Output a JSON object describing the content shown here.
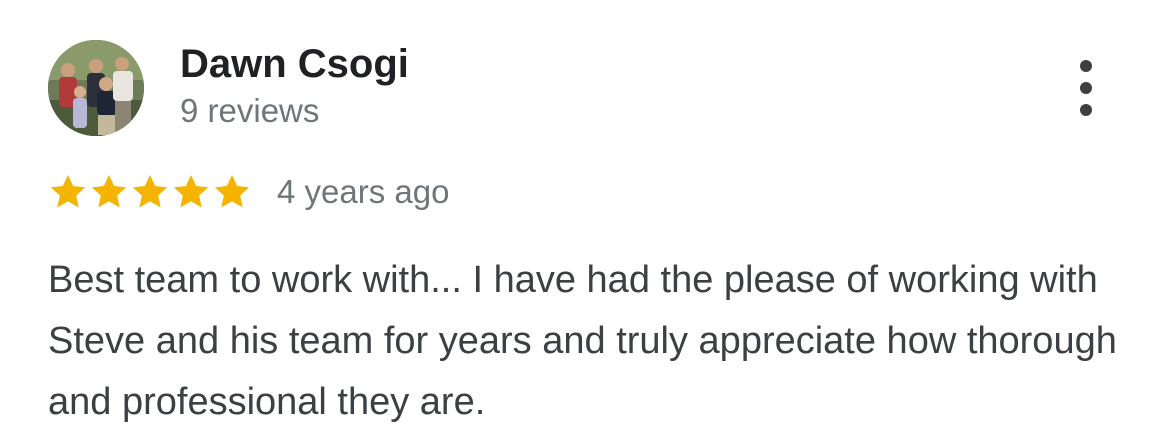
{
  "reviewer": {
    "name": "Dawn Csogi",
    "review_count": "9 reviews",
    "avatar_icon": "family-photo-avatar"
  },
  "review": {
    "rating": 5,
    "rating_max": 5,
    "date": "4 years ago",
    "text": "Best team to work with... I have had the please of working with Steve and his team for years and truly appreciate how thorough and professional they are."
  },
  "menu": {
    "icon": "more-vertical-icon"
  },
  "colors": {
    "star": "#f4b400",
    "name": "#202124",
    "secondary_text": "#70757a",
    "body_text": "#3c4043"
  }
}
